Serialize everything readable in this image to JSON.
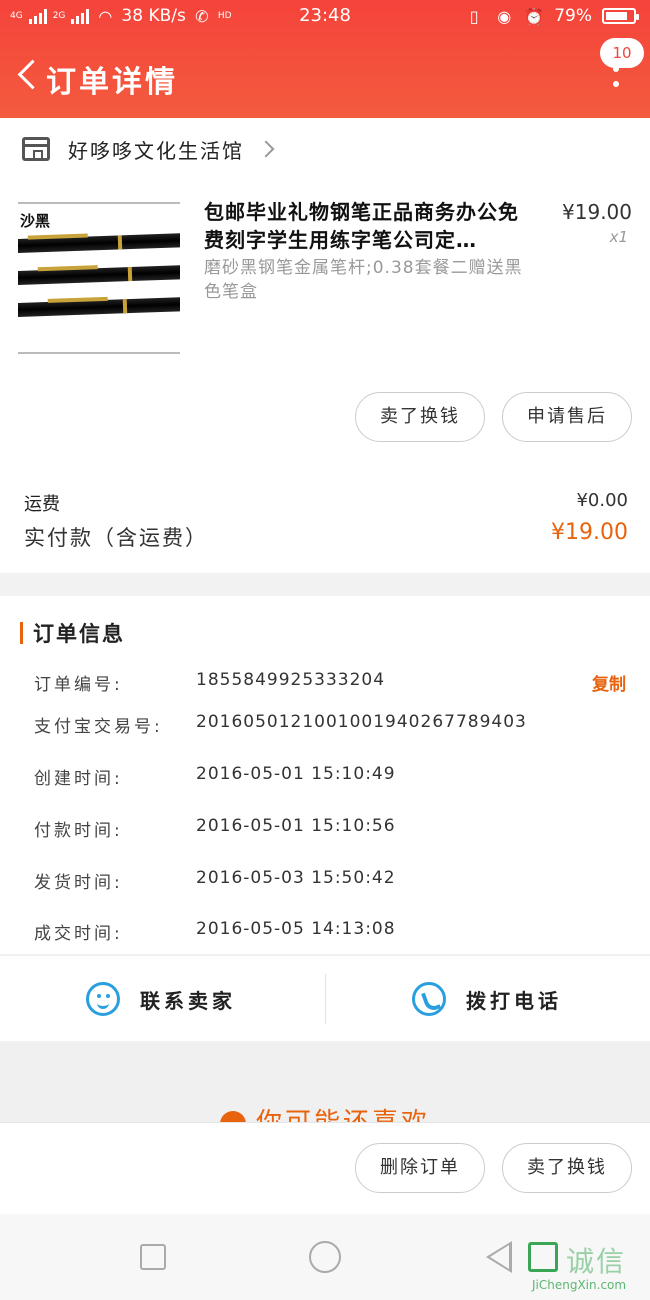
{
  "status_bar": {
    "net_left": "4G",
    "net_right": "2G",
    "speed": "38 KB/s",
    "hd": "HD",
    "time": "23:48",
    "battery": "79%",
    "battery_level": 0.79
  },
  "header": {
    "title": "订单详情",
    "badge_count": "10"
  },
  "shop": {
    "name": "好哆哆文化生活馆"
  },
  "product": {
    "image_label": "沙黑",
    "name": "包邮毕业礼物钢笔正品商务办公免费刻字学生用练字笔公司定…",
    "spec": "磨砂黑钢笔金属笔杆;0.38套餐二赠送黑色笔盒",
    "price": "¥19.00",
    "qty": "x1"
  },
  "item_actions": {
    "sell": "卖了换钱",
    "after_sale": "申请售后"
  },
  "summary": {
    "shipping_label": "运费",
    "shipping_value": "¥0.00",
    "paid_label": "实付款（含运费）",
    "paid_value": "¥19.00"
  },
  "order_info": {
    "title": "订单信息",
    "copy_label": "复制",
    "rows": [
      {
        "key": "订单编号:",
        "value": "1855849925333204"
      },
      {
        "key": "支付宝交易号:",
        "value": "2016050121001001940267789403"
      },
      {
        "key": "创建时间:",
        "value": "2016-05-01 15:10:49"
      },
      {
        "key": "付款时间:",
        "value": "2016-05-01 15:10:56"
      },
      {
        "key": "发货时间:",
        "value": "2016-05-03 15:50:42"
      },
      {
        "key": "成交时间:",
        "value": "2016-05-05 14:13:08"
      }
    ]
  },
  "contact": {
    "chat_label": "联系卖家",
    "call_label": "拨打电话"
  },
  "recommend": {
    "text": "你可能还喜欢"
  },
  "bottom_actions": {
    "delete": "删除订单",
    "sell": "卖了换钱"
  },
  "watermark": {
    "cn": "诚信",
    "en": "JiChengXin.com"
  },
  "colors": {
    "header": "#f5433b",
    "accent": "#e8630e",
    "link": "#2a9fe0"
  }
}
